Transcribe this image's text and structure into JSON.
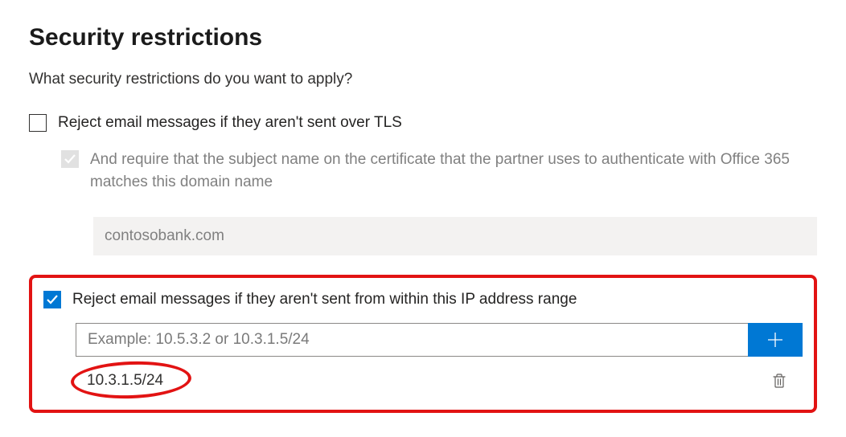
{
  "heading": "Security restrictions",
  "prompt": "What security restrictions do you want to apply?",
  "option_tls": {
    "label": "Reject email messages if they aren't sent over TLS",
    "checked": false,
    "sub_label": "And require that the subject name on the certificate that the partner uses to authenticate with Office 365 matches this domain name",
    "domain_value": "contosobank.com"
  },
  "option_ip": {
    "label": "Reject email messages if they aren't sent from within this IP address range",
    "checked": true,
    "input_placeholder": "Example: 10.5.3.2 or 10.3.1.5/24",
    "input_value": "",
    "entries": [
      "10.3.1.5/24"
    ]
  }
}
